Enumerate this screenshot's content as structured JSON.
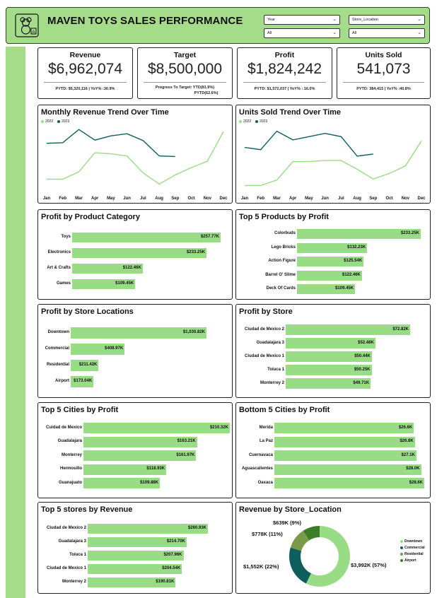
{
  "header": {
    "title": "MAVEN TOYS SALES PERFORMANCE",
    "logo": "teddy-bear-icon"
  },
  "slicers": [
    {
      "title": "Year",
      "value": "All"
    },
    {
      "title": "Store_Location",
      "value": "All"
    }
  ],
  "kpis": [
    {
      "label": "Revenue",
      "value": "$6,962,074",
      "sub1": "PYTD: $5,320,116  |  YoY% :30.9%",
      "sub2": ""
    },
    {
      "label": "Target",
      "value": "$8,500,000",
      "sub1": "Progress To Target: YTD(81.9%)",
      "sub2": "PYTD(62.6%)"
    },
    {
      "label": "Profit",
      "value": "$1,824,242",
      "sub1": "PYTD: $1,572,037  |  YoY% : 16.0%",
      "sub2": ""
    },
    {
      "label": "Units Sold",
      "value": "541,073",
      "sub1": "PYTD: 384,415  |  YoY% :40.8%",
      "sub2": ""
    }
  ],
  "colors": {
    "accent": "#a4dc8a",
    "bar": "#98dc86",
    "y2022": "#98dc86",
    "y2023": "#0f5e5e",
    "commercial": "#0f5e5e",
    "residential": "#7a9a4a",
    "airport": "#3d7d2a"
  },
  "chart_data": [
    {
      "type": "line",
      "title": "Monthly Revenue Trend Over Time",
      "categories": [
        "Jan",
        "Feb",
        "Mar",
        "Apr",
        "May",
        "Jun",
        "Jul",
        "Aug",
        "Sep",
        "Oct",
        "Nov",
        "Dec"
      ],
      "series": [
        {
          "name": "2022",
          "values": [
            248,
            248,
            262,
            298,
            296,
            292,
            260,
            239,
            256,
            270,
            282,
            338
          ]
        },
        {
          "name": "2023",
          "values": [
            316,
            317,
            342,
            322,
            330,
            334,
            321,
            292,
            291,
            null,
            null,
            null
          ]
        }
      ],
      "ylim": [
        230,
        345
      ]
    },
    {
      "type": "line",
      "title": "Units Sold Trend Over Time",
      "categories": [
        "Jan",
        "Feb",
        "Mar",
        "Apr",
        "May",
        "Jun",
        "Jul",
        "Aug",
        "Sep",
        "Oct",
        "Nov",
        "Dec"
      ],
      "series": [
        {
          "name": "2022",
          "values": [
            15,
            15,
            20,
            37,
            37,
            38,
            38,
            30,
            21,
            26,
            33,
            56
          ]
        },
        {
          "name": "2023",
          "values": [
            50,
            48,
            65,
            57,
            60,
            63,
            60,
            42,
            44,
            null,
            null,
            null
          ]
        }
      ],
      "ylim": [
        12,
        68
      ]
    },
    {
      "type": "bar",
      "title": "Profit by Product Category",
      "categories": [
        "Toys",
        "Electronics",
        "Art & Crafts",
        "Games"
      ],
      "values": [
        257.77,
        233.25,
        122.46,
        109.45
      ],
      "labels": [
        "$257.77K",
        "$233.25K",
        "$122.46K",
        "$109.45K"
      ]
    },
    {
      "type": "bar",
      "title": "Top 5 Products by Profit",
      "categories": [
        "Colorbuds",
        "Lego Bricks",
        "Action Figure",
        "Barrel O' Slime",
        "Deck Of Cards"
      ],
      "values": [
        233.25,
        132.23,
        125.54,
        122.46,
        109.45
      ],
      "labels": [
        "$233.25K",
        "$132.23K",
        "$125.54K",
        "$122.46K",
        "$109.45K"
      ]
    },
    {
      "type": "bar",
      "title": "Profit by Store Locations",
      "categories": [
        "Downtown",
        "Commercial",
        "Residential",
        "Airport"
      ],
      "values": [
        1030.82,
        408.97,
        211.42,
        173.04
      ],
      "labels": [
        "$1,030.82K",
        "$408.97K",
        "$211.42K",
        "$173.04K"
      ]
    },
    {
      "type": "bar",
      "title": "Profit by Store",
      "categories": [
        "Ciudad de Mexico 2",
        "Guadalajara 3",
        "Ciudad de Mexico 1",
        "Toluca 1",
        "Monterrey 2"
      ],
      "values": [
        72.82,
        52.48,
        50.44,
        50.25,
        49.71
      ],
      "labels": [
        "$72.82K",
        "$52.48K",
        "$50.44K",
        "$50.25K",
        "$49.71K"
      ]
    },
    {
      "type": "bar",
      "title": "Top 5 Cities by Profit",
      "categories": [
        "Cuidad de Mexico",
        "Guadalajara",
        "Monterrey",
        "Hermosillo",
        "Guanajuato"
      ],
      "values": [
        210.32,
        163.21,
        161.97,
        118.93,
        109.88
      ],
      "labels": [
        "$210.32K",
        "$163.21K",
        "$161.97K",
        "$118.93K",
        "$109.88K"
      ]
    },
    {
      "type": "bar",
      "title": "Bottom 5 Cities by Profit",
      "categories": [
        "Merida",
        "La Paz",
        "Cuernavaca",
        "Aguascalientes",
        "Oaxaca"
      ],
      "values": [
        26.6,
        26.8,
        27.1,
        28.0,
        28.6
      ],
      "labels": [
        "$26.6K",
        "$26.8K",
        "$27.1K",
        "$28.0K",
        "$28.6K"
      ]
    },
    {
      "type": "bar",
      "title": "Top 5 stores by Revenue",
      "categories": [
        "Ciudad de Mexico 2",
        "Guadalajara 3",
        "Toluca 1",
        "Ciudad de Mexico 1",
        "Monterrey 2"
      ],
      "values": [
        260.93,
        214.7,
        207.96,
        204.54,
        190.81
      ],
      "labels": [
        "$260.93K",
        "$214.70K",
        "$207.96K",
        "$204.54K",
        "$190.81K"
      ]
    },
    {
      "type": "pie",
      "title": "Revenue by Store_Location",
      "categories": [
        "Downtown",
        "Commercial",
        "Residential",
        "Airport"
      ],
      "values": [
        3992,
        1552,
        778,
        639
      ],
      "labels": [
        "$3,992K (57%)",
        "$1,552K (22%)",
        "$778K (11%)",
        "$639K (9%)"
      ]
    }
  ]
}
